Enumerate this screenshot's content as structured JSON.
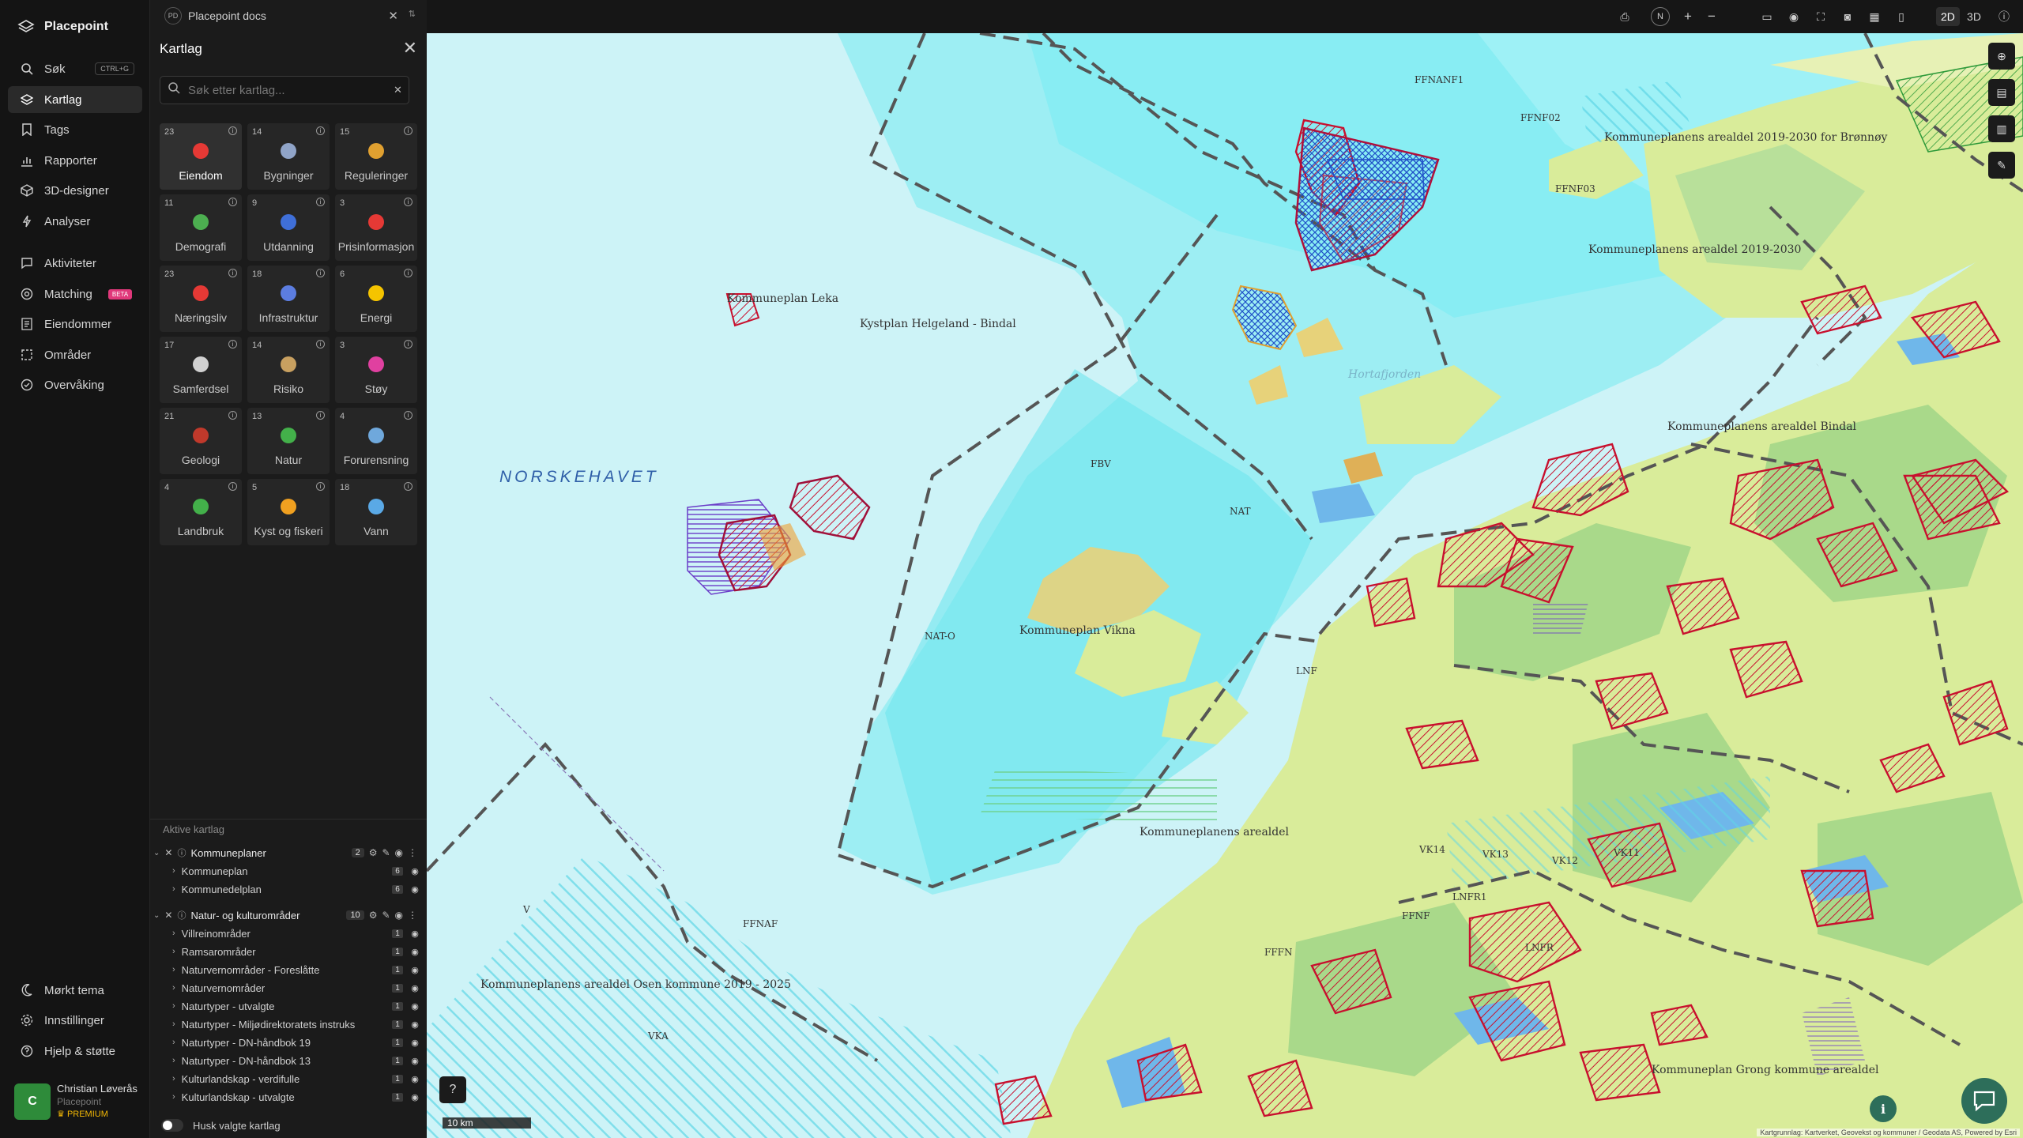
{
  "app": {
    "name": "Placepoint"
  },
  "nav": {
    "items": [
      {
        "label": "Søk",
        "icon": "search-icon",
        "shortcut": "CTRL+G"
      },
      {
        "label": "Kartlag",
        "icon": "layers-icon"
      },
      {
        "label": "Tags",
        "icon": "bookmark-icon"
      },
      {
        "label": "Rapporter",
        "icon": "bar-chart-icon"
      },
      {
        "label": "3D-designer",
        "icon": "cube-icon"
      },
      {
        "label": "Analyser",
        "icon": "bolt-icon"
      },
      {
        "label": "Aktiviteter",
        "icon": "chat-icon"
      },
      {
        "label": "Matching",
        "icon": "target-icon",
        "badge": "BETA"
      },
      {
        "label": "Eiendommer",
        "icon": "document-icon"
      },
      {
        "label": "Områder",
        "icon": "area-icon"
      },
      {
        "label": "Overvåking",
        "icon": "check-circle-icon"
      }
    ],
    "bottom": [
      {
        "label": "Mørkt tema",
        "icon": "moon-icon"
      },
      {
        "label": "Innstillinger",
        "icon": "gear-icon"
      },
      {
        "label": "Hjelp & støtte",
        "icon": "help-icon"
      }
    ],
    "user": {
      "initial": "C",
      "name": "Christian Løverås",
      "org": "Placepoint",
      "plan": "PREMIUM"
    }
  },
  "doc": {
    "badge": "PD",
    "title": "Placepoint docs"
  },
  "panel": {
    "title": "Kartlag",
    "search_placeholder": "Søk etter kartlag...",
    "categories": [
      {
        "count": "23",
        "label": "Eiendom",
        "icon": "pin-icon",
        "color": "#e53935"
      },
      {
        "count": "14",
        "label": "Bygninger",
        "icon": "building-icon",
        "color": "#90a4c8"
      },
      {
        "count": "15",
        "label": "Reguleringer",
        "icon": "signpost-icon",
        "color": "#e0a030"
      },
      {
        "count": "11",
        "label": "Demografi",
        "icon": "demography-icon",
        "color": "#4caf50"
      },
      {
        "count": "9",
        "label": "Utdanning",
        "icon": "graduation-icon",
        "color": "#3f6fd8"
      },
      {
        "count": "3",
        "label": "Prisinformasjon",
        "icon": "shopping-bag-icon",
        "color": "#e53935"
      },
      {
        "count": "23",
        "label": "Næringsliv",
        "icon": "briefcase-icon",
        "color": "#e53935"
      },
      {
        "count": "18",
        "label": "Infrastruktur",
        "icon": "globe-icon",
        "color": "#5c7de0"
      },
      {
        "count": "6",
        "label": "Energi",
        "icon": "lightning-icon",
        "color": "#f5c400"
      },
      {
        "count": "17",
        "label": "Samferdsel",
        "icon": "bus-icon",
        "color": "#d0d0d0"
      },
      {
        "count": "14",
        "label": "Risiko",
        "icon": "hazard-icon",
        "color": "#c8a060"
      },
      {
        "count": "3",
        "label": "Støy",
        "icon": "noise-icon",
        "color": "#e040a0"
      },
      {
        "count": "21",
        "label": "Geologi",
        "icon": "terrain-icon",
        "color": "#c0392b"
      },
      {
        "count": "13",
        "label": "Natur",
        "icon": "leaf-icon",
        "color": "#43b04a"
      },
      {
        "count": "4",
        "label": "Forurensning",
        "icon": "factory-icon",
        "color": "#6fa8dc"
      },
      {
        "count": "4",
        "label": "Landbruk",
        "icon": "sprout-icon",
        "color": "#43b04a"
      },
      {
        "count": "5",
        "label": "Kyst og fiskeri",
        "icon": "fish-icon",
        "color": "#f0a020"
      },
      {
        "count": "18",
        "label": "Vann",
        "icon": "water-drop-icon",
        "color": "#5aa9e6"
      }
    ],
    "active_heading": "Aktive kartlag",
    "active_groups": [
      {
        "label": "Kommuneplaner",
        "count": "2",
        "layers": [
          {
            "label": "Kommuneplan",
            "count": "6"
          },
          {
            "label": "Kommunedelplan",
            "count": "6"
          }
        ]
      },
      {
        "label": "Natur- og kulturområder",
        "count": "10",
        "layers": [
          {
            "label": "Villreinområder",
            "count": "1"
          },
          {
            "label": "Ramsarområder",
            "count": "1"
          },
          {
            "label": "Naturvernområder - Foreslåtte",
            "count": "1"
          },
          {
            "label": "Naturvernområder",
            "count": "1"
          },
          {
            "label": "Naturtyper - utvalgte",
            "count": "1"
          },
          {
            "label": "Naturtyper - Miljødirektoratets instruks",
            "count": "1"
          },
          {
            "label": "Naturtyper - DN-håndbok 19",
            "count": "1"
          },
          {
            "label": "Naturtyper - DN-håndbok 13",
            "count": "1"
          },
          {
            "label": "Kulturlandskap - verdifulle",
            "count": "1"
          },
          {
            "label": "Kulturlandskap - utvalgte",
            "count": "1"
          }
        ]
      }
    ],
    "remember_label": "Husk valgte kartlag"
  },
  "topbar": {
    "compass": "N",
    "zoom_in": "+",
    "zoom_out": "−",
    "view_2d": "2D",
    "view_3d": "3D"
  },
  "map": {
    "sea_label": "NORSKEHAVET",
    "labels": [
      "Kommuneplan Leka",
      "Kystplan Helgeland - Bindal",
      "Kommuneplanens arealdel Osen kommune 2019 - 2025",
      "Kommuneplanens arealdel",
      "Kommuneplanens arealdel 2019-2030 for Brønnøy",
      "Kommuneplanens arealdel Bindal",
      "Kommuneplan Grong kommune arealdel",
      "Kommuneplan Vikna",
      "Hortafjorden",
      "FBV",
      "NAT-O",
      "LNF",
      "FFNF",
      "FFNAF",
      "VKA",
      "VK14",
      "VK13",
      "VK12",
      "VK11",
      "V",
      "FFFN",
      "FFNANF1",
      "FFNF02",
      "FFNF03",
      "NAT",
      "LNFR",
      "LNFR1",
      "Kommuneplanens arealdel 2019-2030"
    ],
    "scale_label": "10 km",
    "attribution": "Kartgrunnlag: Kartverket, Geovekst og kommuner / Geodata AS, Powered by Esri",
    "colors": {
      "sea_open": "#cdf3f7",
      "sea_coastal": "#76e9f0",
      "land": "#d9ec9a",
      "forest": "#a9d98a",
      "plan_border": "#555555",
      "protected": "#c8102e",
      "hatch_blue": "#2050c8"
    }
  }
}
